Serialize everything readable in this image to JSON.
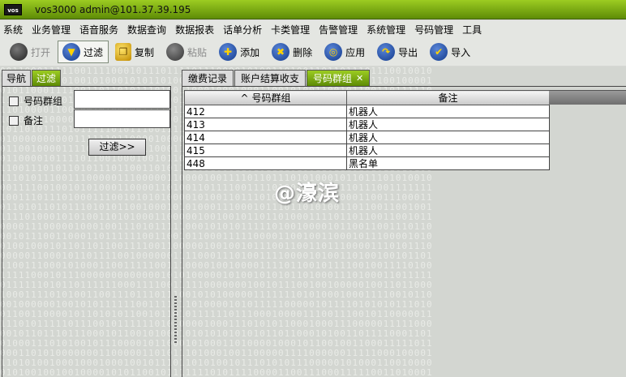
{
  "window": {
    "logo": "vos",
    "title": "vos3000 admin@101.37.39.195"
  },
  "menu": [
    "系统",
    "业务管理",
    "语音服务",
    "数据查询",
    "数据报表",
    "话单分析",
    "卡类管理",
    "告警管理",
    "系统管理",
    "号码管理",
    "工具"
  ],
  "toolbar": [
    {
      "label": "打开",
      "icon": "open-icon",
      "state": "disabled"
    },
    {
      "label": "过滤",
      "icon": "filter-icon",
      "state": "active"
    },
    {
      "label": "复制",
      "icon": "copy-icon",
      "state": "normal"
    },
    {
      "label": "粘贴",
      "icon": "paste-icon",
      "state": "disabled"
    },
    {
      "label": "添加",
      "icon": "add-icon",
      "state": "normal"
    },
    {
      "label": "删除",
      "icon": "delete-icon",
      "state": "normal"
    },
    {
      "label": "应用",
      "icon": "apply-icon",
      "state": "normal"
    },
    {
      "label": "导出",
      "icon": "export-icon",
      "state": "normal"
    },
    {
      "label": "导入",
      "icon": "import-icon",
      "state": "normal"
    }
  ],
  "left_tabs": [
    "导航",
    "过滤"
  ],
  "filter": {
    "field1_label": "号码群组",
    "field1_value": "",
    "field2_label": "备注",
    "field2_value": "",
    "button": "过滤>>"
  },
  "right_tabs": [
    "缴费记录",
    "账户结算收支",
    "号码群组"
  ],
  "close_glyph": "✕",
  "table": {
    "sort_indicator": "^",
    "columns": [
      "号码群组",
      "备注"
    ],
    "rows": [
      [
        "412",
        "机器人"
      ],
      [
        "413",
        "机器人"
      ],
      [
        "414",
        "机器人"
      ],
      [
        "415",
        "机器人"
      ],
      [
        "448",
        "黑名单"
      ]
    ]
  },
  "watermark": "@濠滨",
  "colors": {
    "titlebar": "#7fb213",
    "tab_selected": "#7fb213",
    "workspace": "#d3d6d1"
  }
}
